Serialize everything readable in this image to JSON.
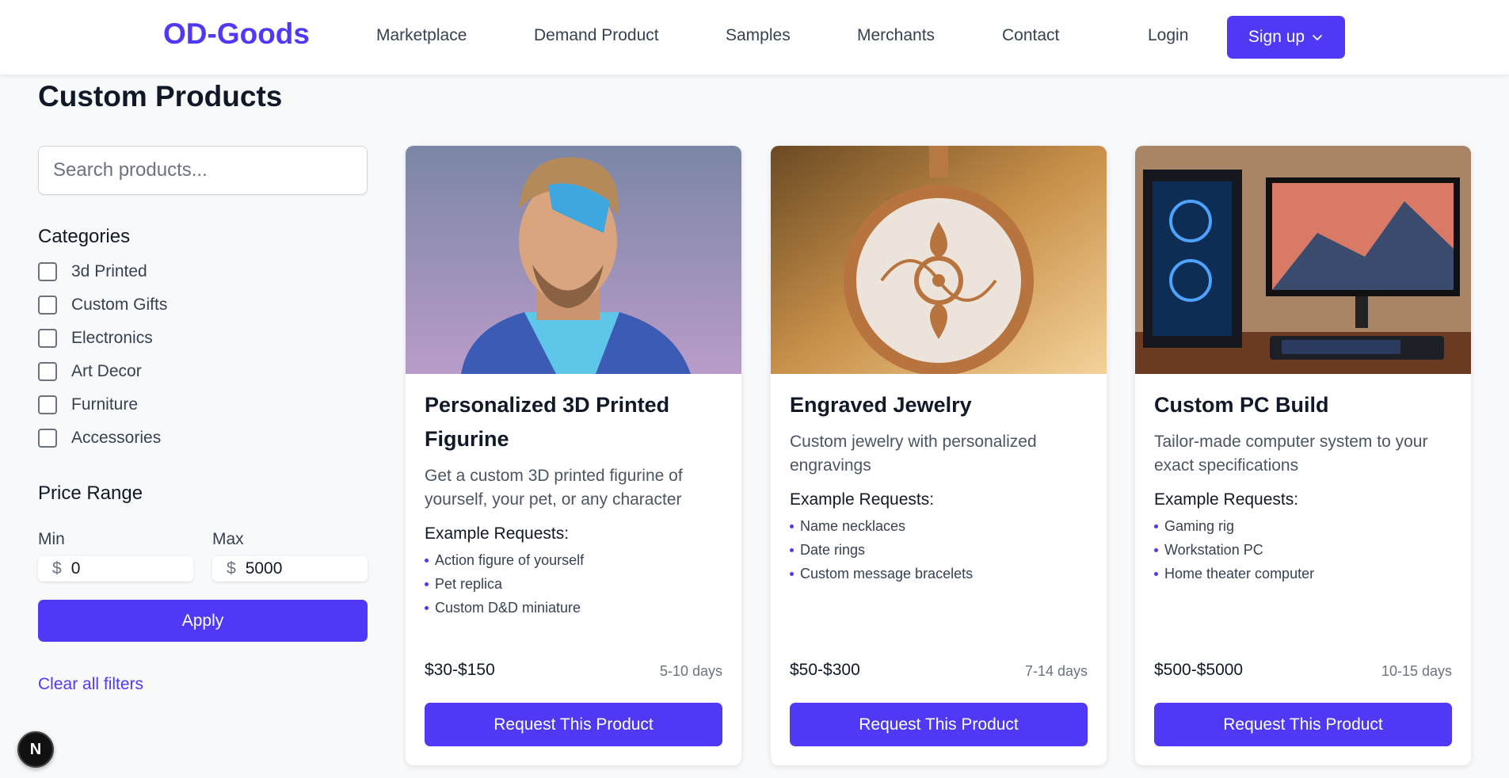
{
  "header": {
    "logo": "OD-Goods",
    "nav": [
      "Marketplace",
      "Demand Product",
      "Samples",
      "Merchants",
      "Contact"
    ],
    "login_label": "Login",
    "signup_label": "Sign up"
  },
  "page": {
    "title": "Custom Products"
  },
  "sidebar": {
    "search_placeholder": "Search products...",
    "categories_title": "Categories",
    "categories": [
      "3d Printed",
      "Custom Gifts",
      "Electronics",
      "Art Decor",
      "Furniture",
      "Accessories"
    ],
    "price_title": "Price Range",
    "min_label": "Min",
    "max_label": "Max",
    "currency": "$",
    "min_value": "0",
    "max_value": "5000",
    "apply_label": "Apply",
    "clear_label": "Clear all filters"
  },
  "cards": [
    {
      "title": "Personalized 3D Printed Figurine",
      "description": "Get a custom 3D printed figurine of yourself, your pet, or any character",
      "examples_title": "Example Requests:",
      "examples": [
        "Action figure of yourself",
        "Pet replica",
        "Custom D&D miniature"
      ],
      "price": "$30-$150",
      "days": "5-10 days",
      "button": "Request This Product"
    },
    {
      "title": "Engraved Jewelry",
      "description": "Custom jewelry with personalized engravings",
      "examples_title": "Example Requests:",
      "examples": [
        "Name necklaces",
        "Date rings",
        "Custom message bracelets"
      ],
      "price": "$50-$300",
      "days": "7-14 days",
      "button": "Request This Product"
    },
    {
      "title": "Custom PC Build",
      "description": "Tailor-made computer system to your exact specifications",
      "examples_title": "Example Requests:",
      "examples": [
        "Gaming rig",
        "Workstation PC",
        "Home theater computer"
      ],
      "price": "$500-$5000",
      "days": "10-15 days",
      "button": "Request This Product"
    }
  ],
  "badge": {
    "letter": "N"
  },
  "colors": {
    "accent": "#4f39f6",
    "background": "#f8f9fb"
  }
}
